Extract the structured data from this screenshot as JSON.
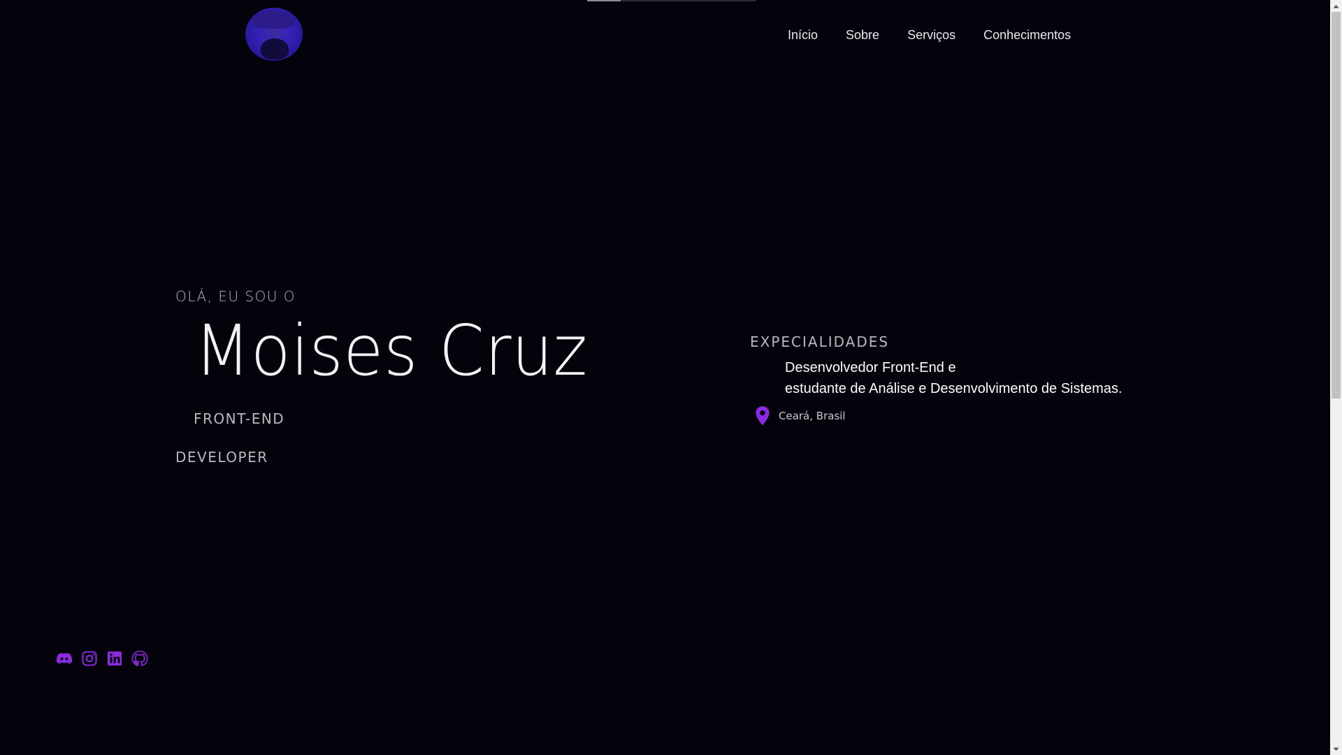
{
  "header": {
    "nav": [
      {
        "label": "Início"
      },
      {
        "label": "Sobre"
      },
      {
        "label": "Serviços"
      },
      {
        "label": "Conhecimentos"
      }
    ]
  },
  "hero": {
    "greeting": "OLÁ, EU SOU O",
    "name": "Moises Cruz",
    "role_line1": "FRONT-END",
    "role_line2": "DEVELOPER"
  },
  "specialties": {
    "title": "EXPECIALIDADES",
    "line1": "Desenvolvedor Front-End e",
    "line2": "estudante de Análise e Desenvolvimento de Sistemas.",
    "location": "Ceará, Brasil"
  },
  "socials": [
    {
      "icon": "discord-icon"
    },
    {
      "icon": "instagram-icon"
    },
    {
      "icon": "linkedin-icon"
    },
    {
      "icon": "github-icon"
    }
  ],
  "colors": {
    "background": "#04030c",
    "accent": "#8a2be2",
    "text": "#ffffff",
    "muted": "#b9b9c2"
  }
}
